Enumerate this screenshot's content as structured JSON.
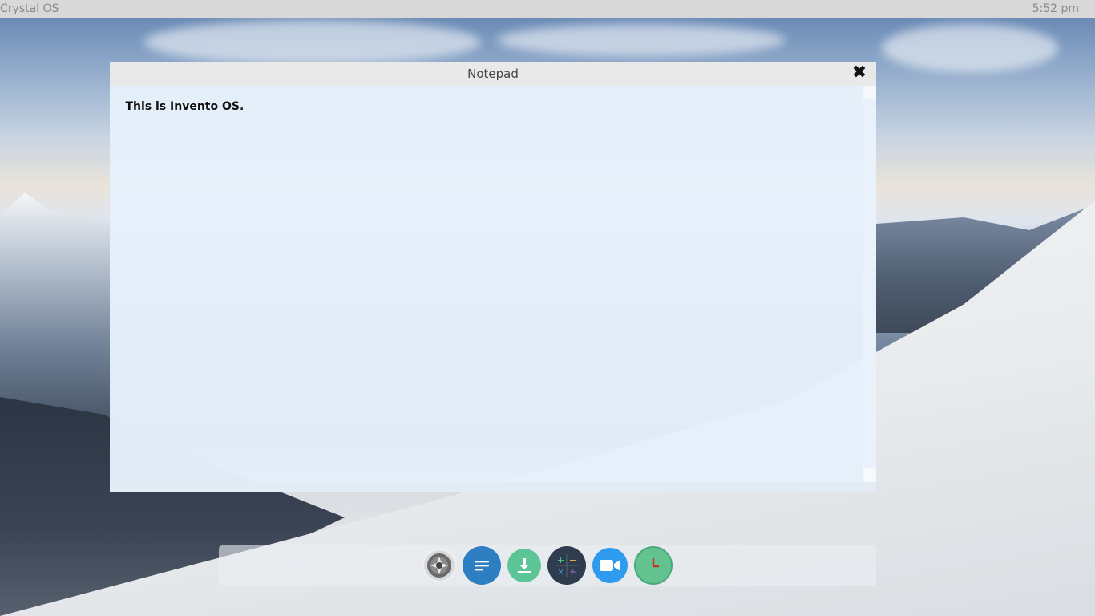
{
  "topbar": {
    "os_name": "Crystal OS",
    "time": "5:52 pm"
  },
  "notepad": {
    "title": "Notepad",
    "content": "This is Invento OS."
  },
  "dock": {
    "items": [
      {
        "name": "settings",
        "icon": "gear-icon"
      },
      {
        "name": "notepad",
        "icon": "notes-icon"
      },
      {
        "name": "downloads",
        "icon": "download-icon"
      },
      {
        "name": "calculator",
        "icon": "calculator-icon"
      },
      {
        "name": "video",
        "icon": "video-camera-icon"
      },
      {
        "name": "clock",
        "icon": "clock-icon"
      }
    ]
  },
  "colors": {
    "topbar_bg": "#d8d8d8",
    "notes_icon": "#2d7fc1",
    "download_icon": "#5cc596",
    "calculator_icon": "#2f3c4e",
    "video_icon": "#2f9bef",
    "clock_icon": "#62c391"
  }
}
